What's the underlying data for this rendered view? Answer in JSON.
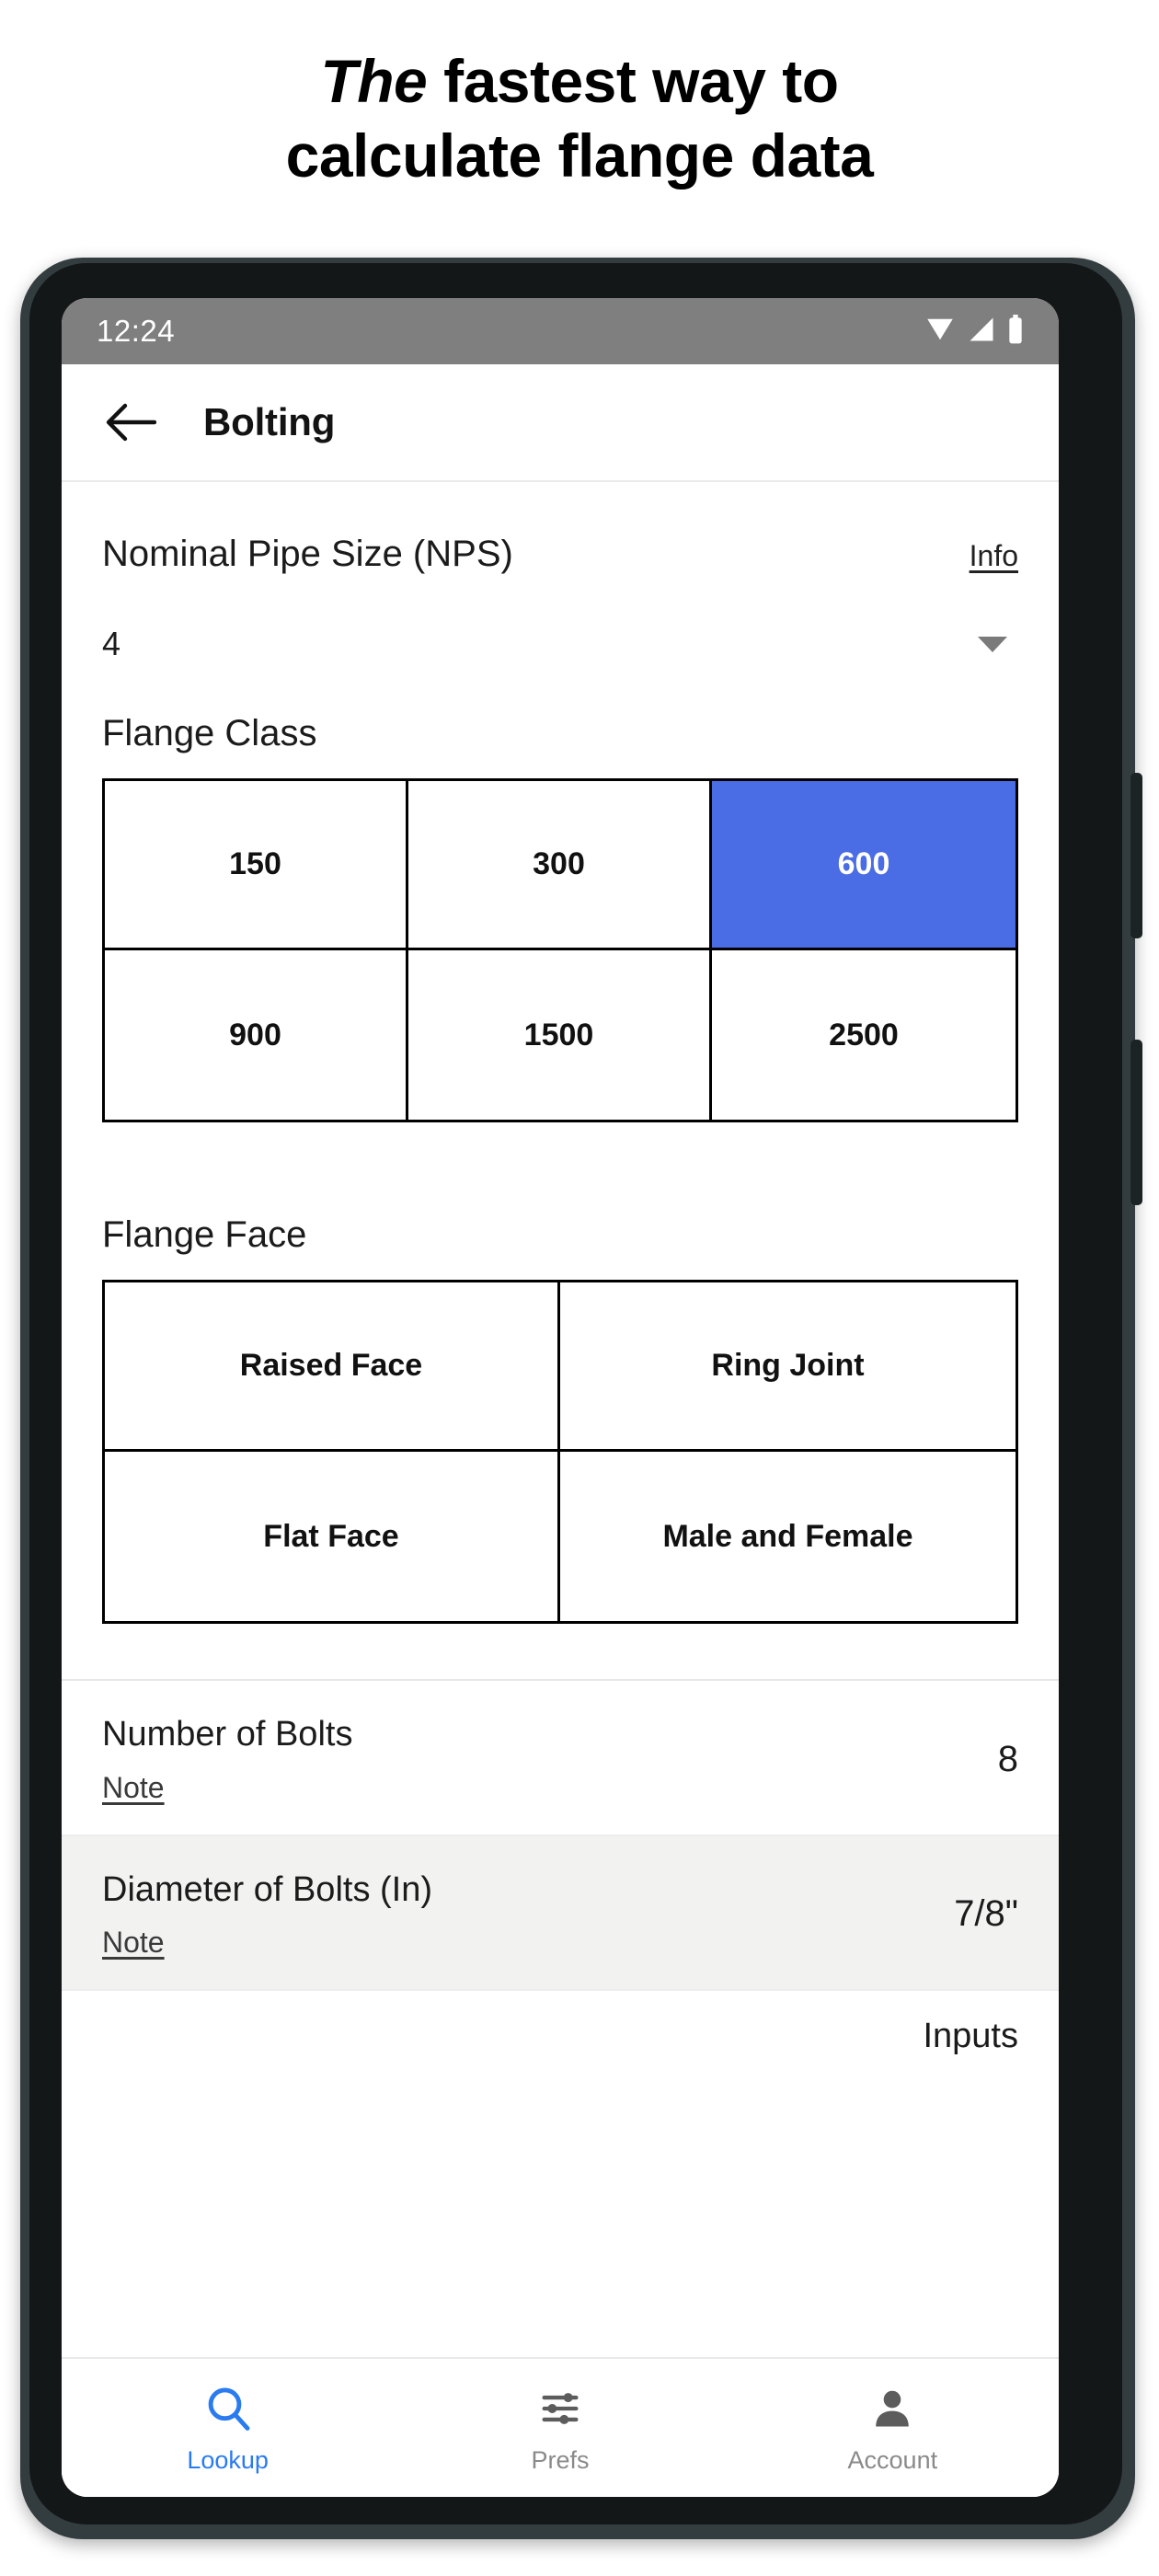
{
  "headline": {
    "emphasis": "The",
    "rest": " fastest way to",
    "line2": "calculate flange data"
  },
  "phone": {
    "status_bar": {
      "time": "12:24",
      "icons": [
        "wifi-icon",
        "cell-signal-icon",
        "battery-icon"
      ]
    },
    "app_bar": {
      "back_icon": "back-arrow-icon",
      "title": "Bolting"
    },
    "nps": {
      "label": "Nominal Pipe Size (NPS)",
      "info_link": "Info",
      "selected_value": "4",
      "caret_icon": "chevron-down-icon"
    },
    "flange_class": {
      "label": "Flange Class",
      "options": [
        "150",
        "300",
        "600",
        "900",
        "1500",
        "2500"
      ],
      "selected": "600",
      "selected_color": "#4a6ce4"
    },
    "flange_face": {
      "label": "Flange Face",
      "options": [
        "Raised Face",
        "Ring Joint",
        "Flat Face",
        "Male and Female"
      ],
      "selected": null
    },
    "results": [
      {
        "label": "Number of Bolts",
        "note": "Note",
        "value": "8",
        "alt": false
      },
      {
        "label": "Diameter of Bolts (In)",
        "note": "Note",
        "value": "7/8\"",
        "alt": true
      }
    ],
    "clipped_row": {
      "text": "Inputs"
    },
    "bottom_nav": {
      "active_color": "#2a7bf0",
      "items": [
        {
          "label": "Lookup",
          "icon": "search-icon",
          "active": true
        },
        {
          "label": "Prefs",
          "icon": "sliders-icon",
          "active": false
        },
        {
          "label": "Account",
          "icon": "person-icon",
          "active": false
        }
      ]
    }
  }
}
